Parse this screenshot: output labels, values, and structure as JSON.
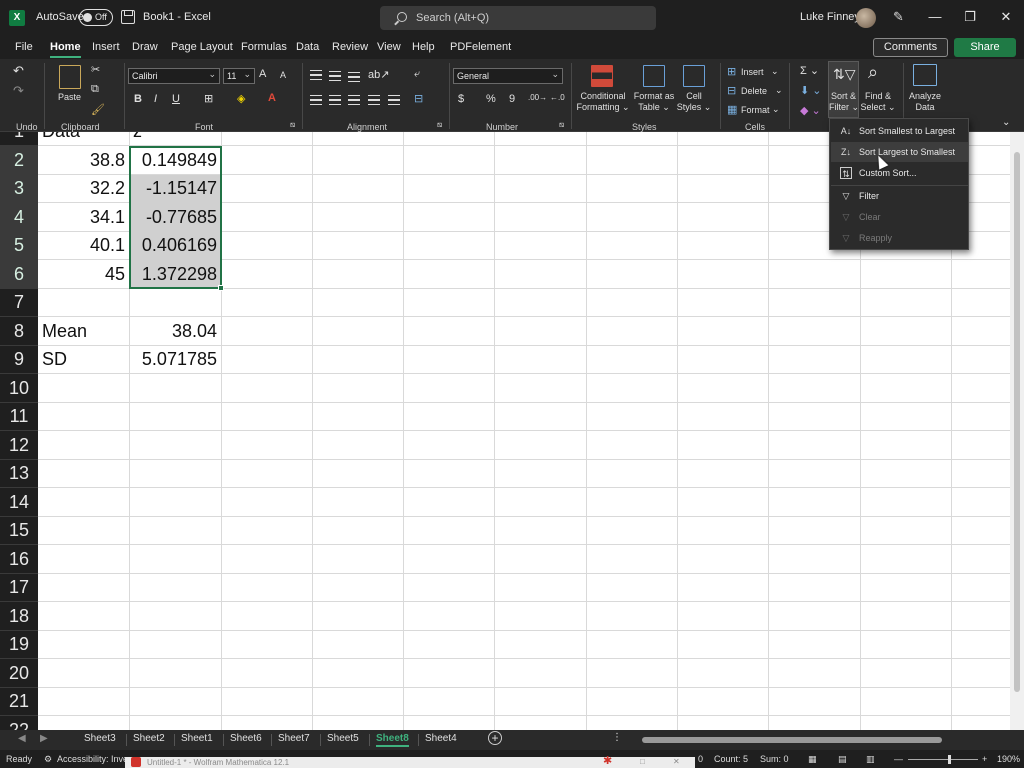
{
  "titlebar": {
    "app_logo": "X",
    "autosave_label": "AutoSave",
    "autosave_state": "Off",
    "doc_title": "Book1 - Excel",
    "search_placeholder": "Search (Alt+Q)",
    "user_name": "Luke Finney",
    "min": "—",
    "max": "❐",
    "close": "✕"
  },
  "menu": {
    "tabs": [
      "File",
      "Home",
      "Insert",
      "Draw",
      "Page Layout",
      "Formulas",
      "Data",
      "Review",
      "View",
      "Help",
      "PDFelement"
    ],
    "active": "Home",
    "comments": "Comments",
    "share": "Share"
  },
  "ribbon": {
    "undo_label": "Undo",
    "clipboard_label": "Clipboard",
    "paste": "Paste",
    "font_label": "Font",
    "font_name": "Calibri",
    "font_size": "11",
    "alignment_label": "Alignment",
    "number_label": "Number",
    "number_format": "General",
    "styles_label": "Styles",
    "conditional_formatting": [
      "Conditional",
      "Formatting ⌄"
    ],
    "format_as_table": [
      "Format as",
      "Table ⌄"
    ],
    "cell_styles": [
      "Cell",
      "Styles ⌄"
    ],
    "cells_label": "Cells",
    "insert": "Insert",
    "delete": "Delete",
    "format": "Format",
    "sort_filter": [
      "Sort &",
      "Filter ⌄"
    ],
    "find_select": [
      "Find &",
      "Select ⌄"
    ],
    "analyze_data": [
      "Analyze",
      "Data"
    ]
  },
  "grid": {
    "row_headers": [
      "1",
      "2",
      "3",
      "4",
      "5",
      "6",
      "7",
      "8",
      "9",
      "10",
      "11",
      "12",
      "13",
      "14",
      "15",
      "16",
      "17",
      "18",
      "19",
      "20",
      "21",
      "22"
    ],
    "row1_a": "Data",
    "row1_b": "z",
    "rows": [
      {
        "a": "38.8",
        "b": "0.149849"
      },
      {
        "a": "32.2",
        "b": "-1.15147"
      },
      {
        "a": "34.1",
        "b": "-0.77685"
      },
      {
        "a": "40.1",
        "b": "0.406169"
      },
      {
        "a": "45",
        "b": "1.372298"
      }
    ],
    "mean_label": "Mean",
    "mean_value": "38.04",
    "sd_label": "SD",
    "sd_value": "5.071785"
  },
  "sort_menu": {
    "items": [
      {
        "label": "Sort Smallest to Largest",
        "icon": "sort-ascending-icon",
        "glyph": "A↓"
      },
      {
        "label": "Sort Largest to Smallest",
        "icon": "sort-descending-icon",
        "glyph": "Z↓"
      },
      {
        "label": "Custom Sort...",
        "icon": "custom-sort-icon",
        "glyph": "⇅"
      },
      {
        "label": "Filter",
        "icon": "filter-icon",
        "glyph": "▽"
      },
      {
        "label": "Clear",
        "icon": "clear-filter-icon",
        "glyph": "▽"
      },
      {
        "label": "Reapply",
        "icon": "reapply-icon",
        "glyph": "▽"
      }
    ]
  },
  "sheets": {
    "tabs": [
      "Sheet3",
      "Sheet2",
      "Sheet1",
      "Sheet6",
      "Sheet7",
      "Sheet5",
      "Sheet8",
      "Sheet4"
    ],
    "active": "Sheet8",
    "add": "+"
  },
  "status": {
    "ready": "Ready",
    "accessibility": "Accessibility: Inves",
    "taskbar_app": "Untitled-1 * - Wolfram Mathematica 12.1",
    "count": "Count: 5",
    "sum": "Sum: 0",
    "zoom": "190%"
  }
}
